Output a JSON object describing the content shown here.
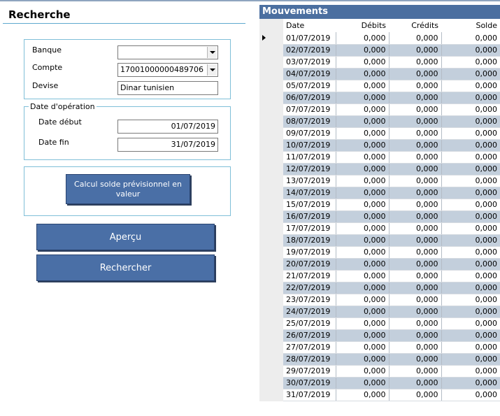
{
  "search": {
    "title": "Recherche",
    "banque_label": "Banque",
    "banque_value": "",
    "compte_label": "Compte",
    "compte_value": "17001000000489706",
    "devise_label": "Devise",
    "devise_value": "Dinar tunisien",
    "date_group_label": "Date d'opération",
    "date_debut_label": "Date début",
    "date_debut_value": "01/07/2019",
    "date_fin_label": "Date fin",
    "date_fin_value": "31/07/2019",
    "calc_button": "Calcul solde prévisionnel en valeur",
    "apercu_button": "Aperçu",
    "rechercher_button": "Rechercher"
  },
  "grid": {
    "title": "Mouvements",
    "columns": [
      "Date",
      "Débits",
      "Crédits",
      "Solde"
    ],
    "rows": [
      [
        "01/07/2019",
        "0,000",
        "0,000",
        "0,000"
      ],
      [
        "02/07/2019",
        "0,000",
        "0,000",
        "0,000"
      ],
      [
        "03/07/2019",
        "0,000",
        "0,000",
        "0,000"
      ],
      [
        "04/07/2019",
        "0,000",
        "0,000",
        "0,000"
      ],
      [
        "05/07/2019",
        "0,000",
        "0,000",
        "0,000"
      ],
      [
        "06/07/2019",
        "0,000",
        "0,000",
        "0,000"
      ],
      [
        "07/07/2019",
        "0,000",
        "0,000",
        "0,000"
      ],
      [
        "08/07/2019",
        "0,000",
        "0,000",
        "0,000"
      ],
      [
        "09/07/2019",
        "0,000",
        "0,000",
        "0,000"
      ],
      [
        "10/07/2019",
        "0,000",
        "0,000",
        "0,000"
      ],
      [
        "11/07/2019",
        "0,000",
        "0,000",
        "0,000"
      ],
      [
        "12/07/2019",
        "0,000",
        "0,000",
        "0,000"
      ],
      [
        "13/07/2019",
        "0,000",
        "0,000",
        "0,000"
      ],
      [
        "14/07/2019",
        "0,000",
        "0,000",
        "0,000"
      ],
      [
        "15/07/2019",
        "0,000",
        "0,000",
        "0,000"
      ],
      [
        "16/07/2019",
        "0,000",
        "0,000",
        "0,000"
      ],
      [
        "17/07/2019",
        "0,000",
        "0,000",
        "0,000"
      ],
      [
        "18/07/2019",
        "0,000",
        "0,000",
        "0,000"
      ],
      [
        "19/07/2019",
        "0,000",
        "0,000",
        "0,000"
      ],
      [
        "20/07/2019",
        "0,000",
        "0,000",
        "0,000"
      ],
      [
        "21/07/2019",
        "0,000",
        "0,000",
        "0,000"
      ],
      [
        "22/07/2019",
        "0,000",
        "0,000",
        "0,000"
      ],
      [
        "23/07/2019",
        "0,000",
        "0,000",
        "0,000"
      ],
      [
        "24/07/2019",
        "0,000",
        "0,000",
        "0,000"
      ],
      [
        "25/07/2019",
        "0,000",
        "0,000",
        "0,000"
      ],
      [
        "26/07/2019",
        "0,000",
        "0,000",
        "0,000"
      ],
      [
        "27/07/2019",
        "0,000",
        "0,000",
        "0,000"
      ],
      [
        "28/07/2019",
        "0,000",
        "0,000",
        "0,000"
      ],
      [
        "29/07/2019",
        "0,000",
        "0,000",
        "0,000"
      ],
      [
        "30/07/2019",
        "0,000",
        "0,000",
        "0,000"
      ],
      [
        "31/07/2019",
        "0,000",
        "0,000",
        "0,000"
      ]
    ]
  }
}
